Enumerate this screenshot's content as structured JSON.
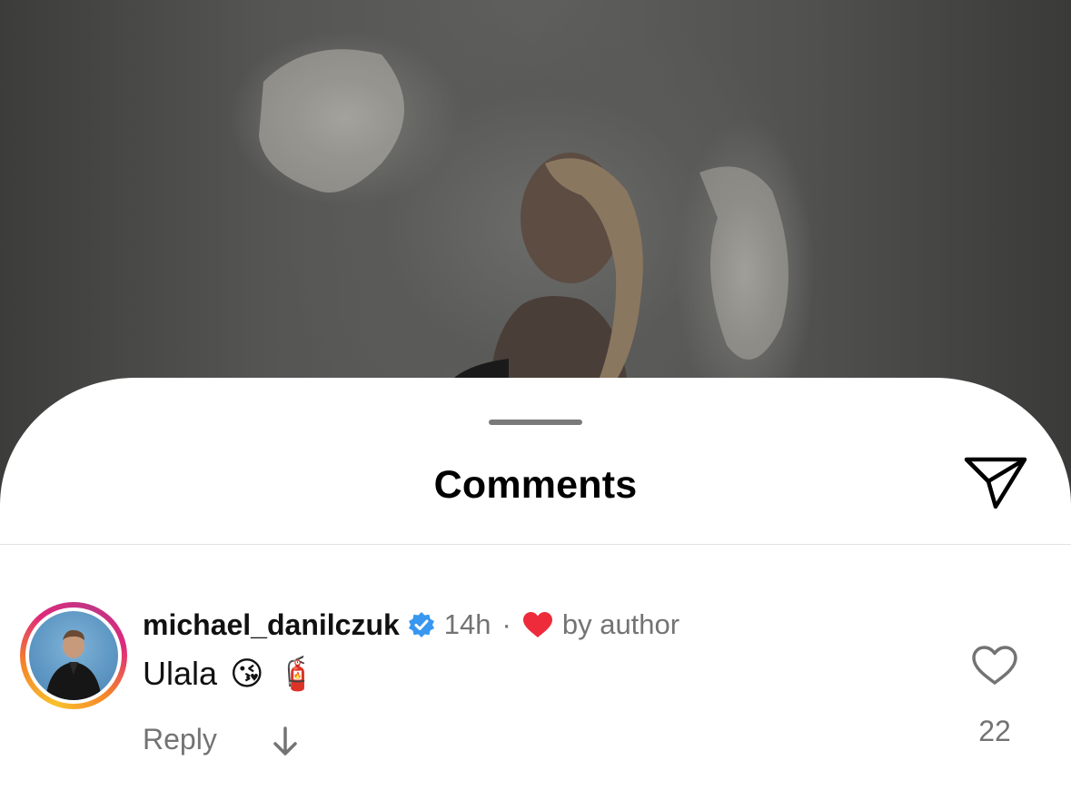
{
  "sheet": {
    "title": "Comments",
    "send_icon": "paper-plane-icon"
  },
  "comments": [
    {
      "username": "michael_danilczuk",
      "verified": true,
      "time": "14h",
      "separator": "·",
      "liked_by_author_label": "by author",
      "text": "Ulala",
      "emojis": [
        "😘",
        "🧯"
      ],
      "reply_label": "Reply",
      "like_count": "22"
    }
  ],
  "colors": {
    "verified_badge": "#3897f0",
    "author_heart": "#ed2b3b",
    "muted_text": "#737373"
  }
}
